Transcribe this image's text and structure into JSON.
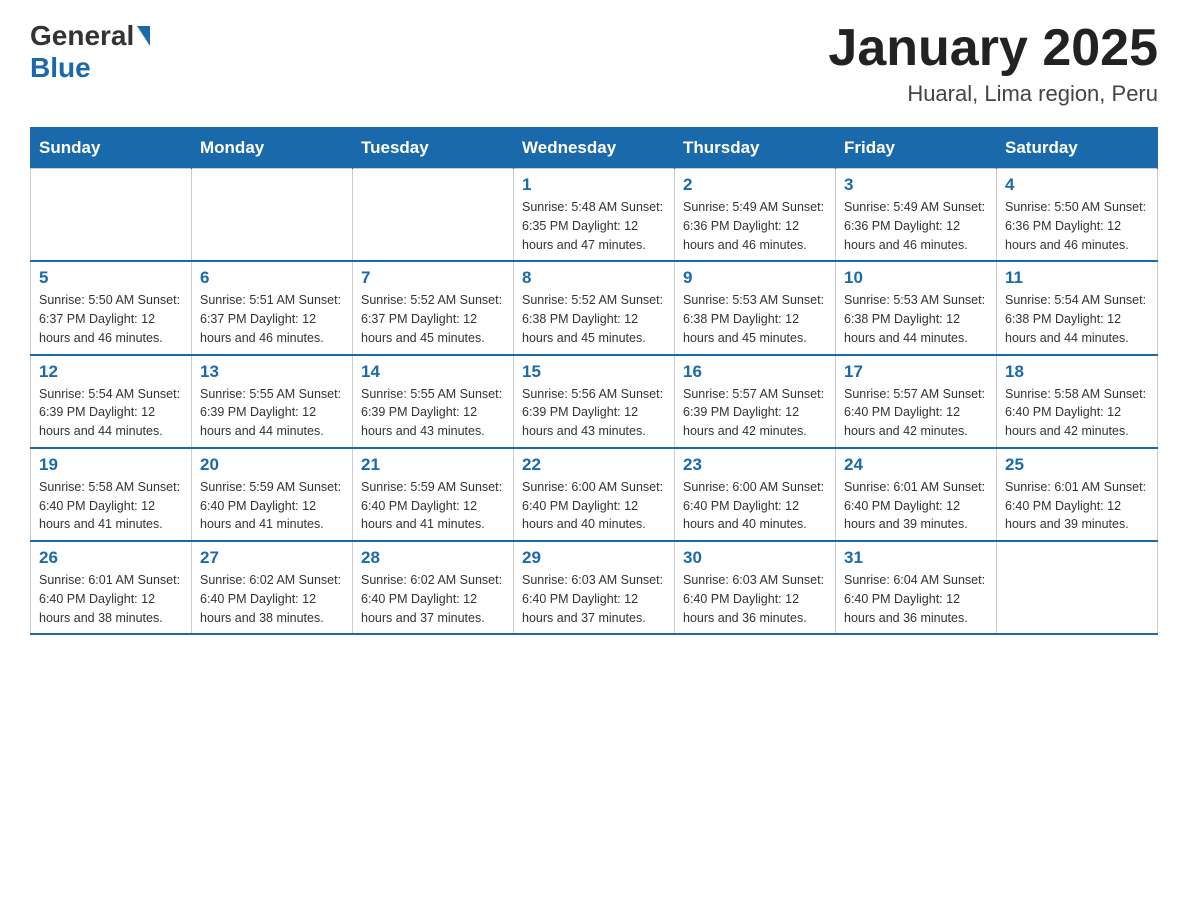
{
  "header": {
    "logo": {
      "general": "General",
      "blue": "Blue"
    },
    "title": "January 2025",
    "subtitle": "Huaral, Lima region, Peru"
  },
  "calendar": {
    "days_of_week": [
      "Sunday",
      "Monday",
      "Tuesday",
      "Wednesday",
      "Thursday",
      "Friday",
      "Saturday"
    ],
    "weeks": [
      [
        {
          "day": "",
          "info": ""
        },
        {
          "day": "",
          "info": ""
        },
        {
          "day": "",
          "info": ""
        },
        {
          "day": "1",
          "info": "Sunrise: 5:48 AM\nSunset: 6:35 PM\nDaylight: 12 hours and 47 minutes."
        },
        {
          "day": "2",
          "info": "Sunrise: 5:49 AM\nSunset: 6:36 PM\nDaylight: 12 hours and 46 minutes."
        },
        {
          "day": "3",
          "info": "Sunrise: 5:49 AM\nSunset: 6:36 PM\nDaylight: 12 hours and 46 minutes."
        },
        {
          "day": "4",
          "info": "Sunrise: 5:50 AM\nSunset: 6:36 PM\nDaylight: 12 hours and 46 minutes."
        }
      ],
      [
        {
          "day": "5",
          "info": "Sunrise: 5:50 AM\nSunset: 6:37 PM\nDaylight: 12 hours and 46 minutes."
        },
        {
          "day": "6",
          "info": "Sunrise: 5:51 AM\nSunset: 6:37 PM\nDaylight: 12 hours and 46 minutes."
        },
        {
          "day": "7",
          "info": "Sunrise: 5:52 AM\nSunset: 6:37 PM\nDaylight: 12 hours and 45 minutes."
        },
        {
          "day": "8",
          "info": "Sunrise: 5:52 AM\nSunset: 6:38 PM\nDaylight: 12 hours and 45 minutes."
        },
        {
          "day": "9",
          "info": "Sunrise: 5:53 AM\nSunset: 6:38 PM\nDaylight: 12 hours and 45 minutes."
        },
        {
          "day": "10",
          "info": "Sunrise: 5:53 AM\nSunset: 6:38 PM\nDaylight: 12 hours and 44 minutes."
        },
        {
          "day": "11",
          "info": "Sunrise: 5:54 AM\nSunset: 6:38 PM\nDaylight: 12 hours and 44 minutes."
        }
      ],
      [
        {
          "day": "12",
          "info": "Sunrise: 5:54 AM\nSunset: 6:39 PM\nDaylight: 12 hours and 44 minutes."
        },
        {
          "day": "13",
          "info": "Sunrise: 5:55 AM\nSunset: 6:39 PM\nDaylight: 12 hours and 44 minutes."
        },
        {
          "day": "14",
          "info": "Sunrise: 5:55 AM\nSunset: 6:39 PM\nDaylight: 12 hours and 43 minutes."
        },
        {
          "day": "15",
          "info": "Sunrise: 5:56 AM\nSunset: 6:39 PM\nDaylight: 12 hours and 43 minutes."
        },
        {
          "day": "16",
          "info": "Sunrise: 5:57 AM\nSunset: 6:39 PM\nDaylight: 12 hours and 42 minutes."
        },
        {
          "day": "17",
          "info": "Sunrise: 5:57 AM\nSunset: 6:40 PM\nDaylight: 12 hours and 42 minutes."
        },
        {
          "day": "18",
          "info": "Sunrise: 5:58 AM\nSunset: 6:40 PM\nDaylight: 12 hours and 42 minutes."
        }
      ],
      [
        {
          "day": "19",
          "info": "Sunrise: 5:58 AM\nSunset: 6:40 PM\nDaylight: 12 hours and 41 minutes."
        },
        {
          "day": "20",
          "info": "Sunrise: 5:59 AM\nSunset: 6:40 PM\nDaylight: 12 hours and 41 minutes."
        },
        {
          "day": "21",
          "info": "Sunrise: 5:59 AM\nSunset: 6:40 PM\nDaylight: 12 hours and 41 minutes."
        },
        {
          "day": "22",
          "info": "Sunrise: 6:00 AM\nSunset: 6:40 PM\nDaylight: 12 hours and 40 minutes."
        },
        {
          "day": "23",
          "info": "Sunrise: 6:00 AM\nSunset: 6:40 PM\nDaylight: 12 hours and 40 minutes."
        },
        {
          "day": "24",
          "info": "Sunrise: 6:01 AM\nSunset: 6:40 PM\nDaylight: 12 hours and 39 minutes."
        },
        {
          "day": "25",
          "info": "Sunrise: 6:01 AM\nSunset: 6:40 PM\nDaylight: 12 hours and 39 minutes."
        }
      ],
      [
        {
          "day": "26",
          "info": "Sunrise: 6:01 AM\nSunset: 6:40 PM\nDaylight: 12 hours and 38 minutes."
        },
        {
          "day": "27",
          "info": "Sunrise: 6:02 AM\nSunset: 6:40 PM\nDaylight: 12 hours and 38 minutes."
        },
        {
          "day": "28",
          "info": "Sunrise: 6:02 AM\nSunset: 6:40 PM\nDaylight: 12 hours and 37 minutes."
        },
        {
          "day": "29",
          "info": "Sunrise: 6:03 AM\nSunset: 6:40 PM\nDaylight: 12 hours and 37 minutes."
        },
        {
          "day": "30",
          "info": "Sunrise: 6:03 AM\nSunset: 6:40 PM\nDaylight: 12 hours and 36 minutes."
        },
        {
          "day": "31",
          "info": "Sunrise: 6:04 AM\nSunset: 6:40 PM\nDaylight: 12 hours and 36 minutes."
        },
        {
          "day": "",
          "info": ""
        }
      ]
    ]
  }
}
